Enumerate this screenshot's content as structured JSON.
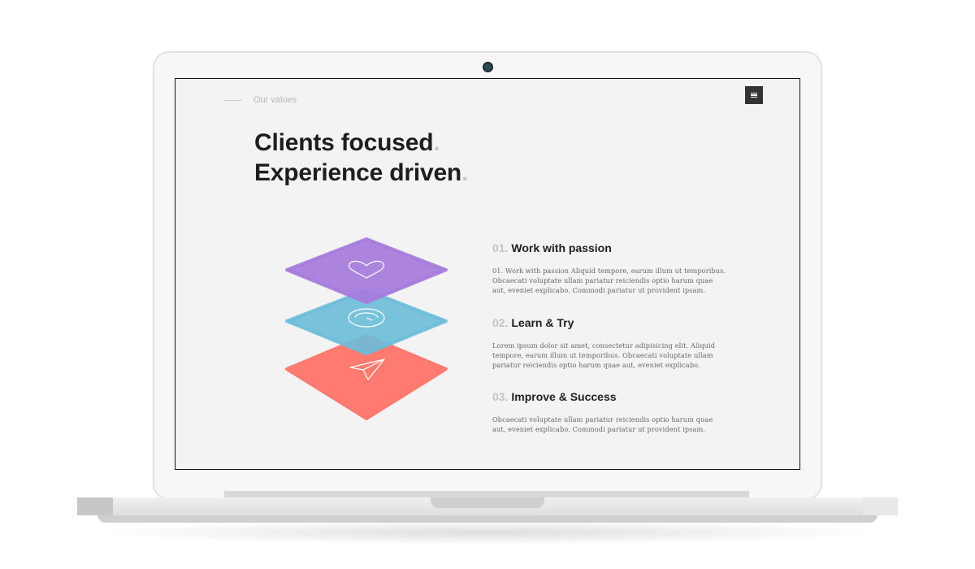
{
  "page": {
    "section_label": "Our values",
    "menu_icon": "hamburger-menu-icon"
  },
  "headline": {
    "line1": "Clients focused",
    "line2": "Experience driven",
    "dot": "."
  },
  "layers": {
    "colors": {
      "purple": "#a67bdb",
      "blue": "#6cbcd9",
      "coral": "#ff7b72"
    },
    "icons": [
      "heart-icon",
      "speedometer-icon",
      "paper-plane-icon"
    ]
  },
  "values": [
    {
      "number": "01.",
      "title": "Work with passion",
      "body": "01. Work with passion Aliquid tempore, earum illum ut temporibus. Obcaecati voluptate ullam pariatur reiciendis optio harum quae aut, eveniet explicabo. Commodi pariatur ut provident ipsam."
    },
    {
      "number": "02.",
      "title": "Learn & Try",
      "body": "Lorem ipsum dolor sit amet, consectetur adipisicing elit. Aliquid tempore, earum illum ut temporibus. Obcaecati voluptate ullam pariatur reiciendis optio harum quae aut, eveniet explicabo."
    },
    {
      "number": "03.",
      "title": "Improve & Success",
      "body": "Obcaecati voluptate ullam pariatur reiciendis optio harum quae aut, eveniet explicabo. Commodi pariatur ut provident ipsam."
    }
  ]
}
